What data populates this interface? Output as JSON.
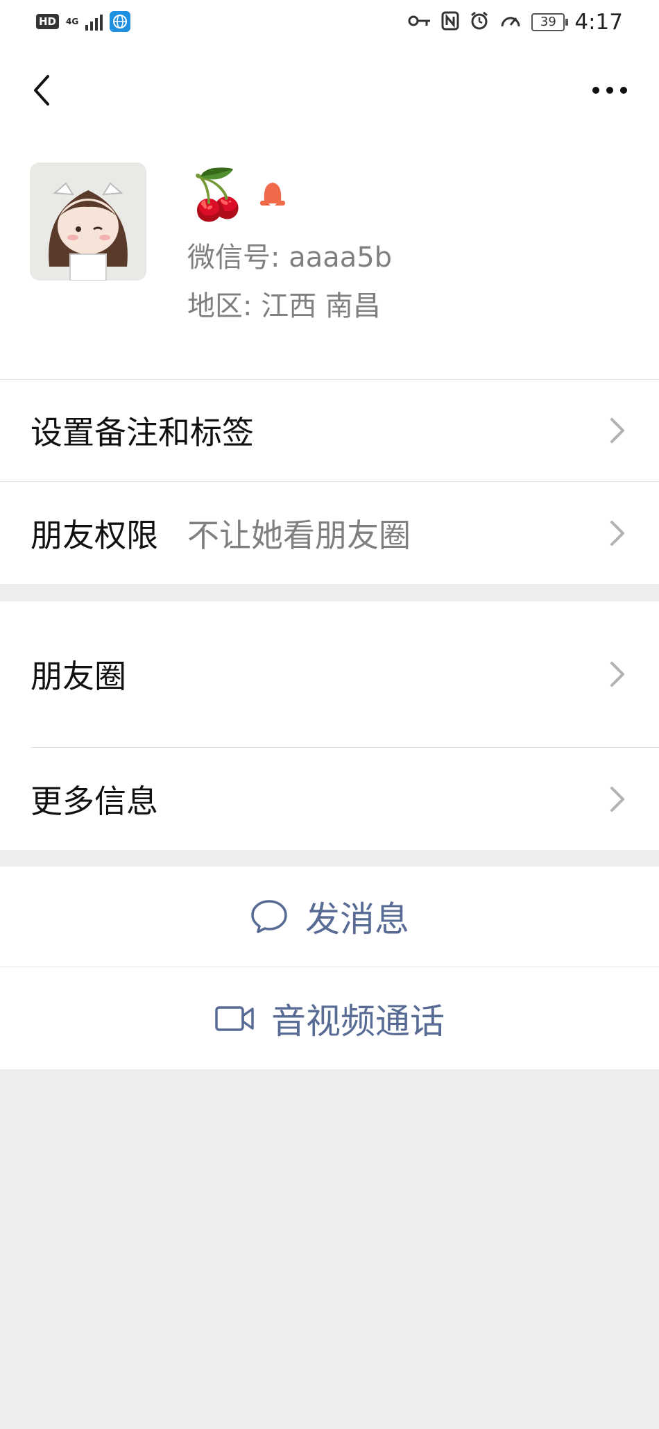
{
  "status_bar": {
    "hd": "HD",
    "network": "4G",
    "battery": "39",
    "time": "4:17"
  },
  "profile": {
    "nickname_emoji": "🍒",
    "wechat_id_line": "微信号: aaaa5b",
    "region_line": "地区: 江西  南昌",
    "gender_color": "#f06a4a"
  },
  "menu": {
    "remark_tags": "设置备注和标签",
    "friend_perm_label": "朋友权限",
    "friend_perm_value": "不让她看朋友圈",
    "moments": "朋友圈",
    "more_info": "更多信息"
  },
  "actions": {
    "send_message": "发消息",
    "av_call": "音视频通话",
    "link_color": "#576b95"
  }
}
